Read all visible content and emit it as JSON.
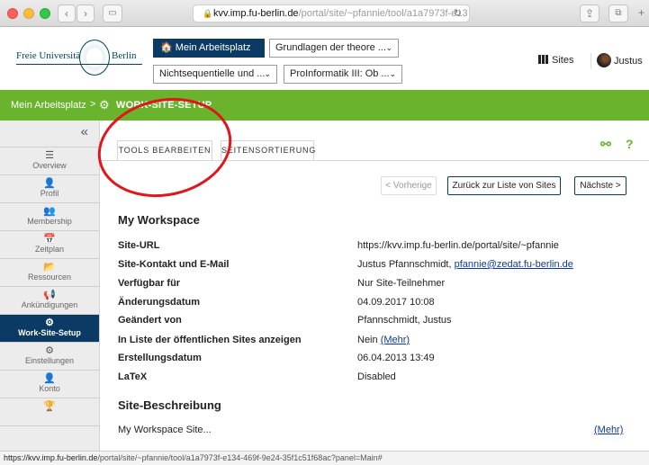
{
  "browser": {
    "url_host": "kvv.imp.fu-berlin.de",
    "url_path": "/portal/site/~pfannie/tool/a1a7973f-e13"
  },
  "header": {
    "logo_left": "Freie Universität",
    "logo_right": "Berlin",
    "mein_arbeitsplatz": "Mein Arbeitsplatz",
    "select1": "Grundlagen der theore ...",
    "select2": "Nichtsequentielle und ...",
    "select3": "ProInformatik III: Ob ...",
    "sites_label": "Sites",
    "user_name": "Justus"
  },
  "breadcrumb": {
    "home": "Mein Arbeitsplatz",
    "separator": ">",
    "current": "WORK-SITE-SETUP"
  },
  "sidebar": {
    "collapse_glyph": "«",
    "items": [
      {
        "label": "Overview",
        "icon": "☰"
      },
      {
        "label": "Profil",
        "icon": "👤"
      },
      {
        "label": "Membership",
        "icon": "👥"
      },
      {
        "label": "Zeitplan",
        "icon": "📅"
      },
      {
        "label": "Ressourcen",
        "icon": "📂"
      },
      {
        "label": "Ankündigungen",
        "icon": "📢"
      },
      {
        "label": "Work-Site-Setup",
        "icon": "⚙"
      },
      {
        "label": "Einstellungen",
        "icon": "⚙"
      },
      {
        "label": "Konto",
        "icon": "👤"
      },
      {
        "label": "",
        "icon": "🏆"
      }
    ]
  },
  "tabs": {
    "tab1": "TOOLS BEARBEITEN",
    "tab2": "SEITENSORTIERUNG"
  },
  "pager": {
    "prev": "< Vorherige",
    "back": "Zurück zur Liste von Sites",
    "next": "Nächste >"
  },
  "workspace": {
    "title": "My Workspace",
    "rows": [
      {
        "k": "Site-URL",
        "v": "https://kvv.imp.fu-berlin.de/portal/site/~pfannie"
      },
      {
        "k": "Site-Kontakt und E-Mail",
        "v": "Justus Pfannschmidt, ",
        "link": "pfannie@zedat.fu-berlin.de"
      },
      {
        "k": "Verfügbar für",
        "v": "Nur Site-Teilnehmer"
      },
      {
        "k": "Änderungsdatum",
        "v": "04.09.2017 10:08"
      },
      {
        "k": "Geändert von",
        "v": "Pfannschmidt, Justus"
      },
      {
        "k": "In Liste der öffentlichen Sites anzeigen",
        "v": "Nein ",
        "link": "(Mehr)"
      },
      {
        "k": "Erstellungsdatum",
        "v": "06.04.2013 13:49"
      },
      {
        "k": "LaTeX",
        "v": "Disabled"
      }
    ],
    "desc_title": "Site-Beschreibung",
    "desc_text": "My Workspace Site...",
    "desc_more": "(Mehr)"
  },
  "status": {
    "host": "https://kvv.imp.fu-berlin.de",
    "path": "/portal/site/~pfannie/tool/a1a7973f-e134-469f-9e24-35f1c51f68ac?panel=Main#"
  },
  "colors": {
    "green": "#6ab42d",
    "navy": "#0b3a64",
    "annotation_red": "#e0161b"
  }
}
